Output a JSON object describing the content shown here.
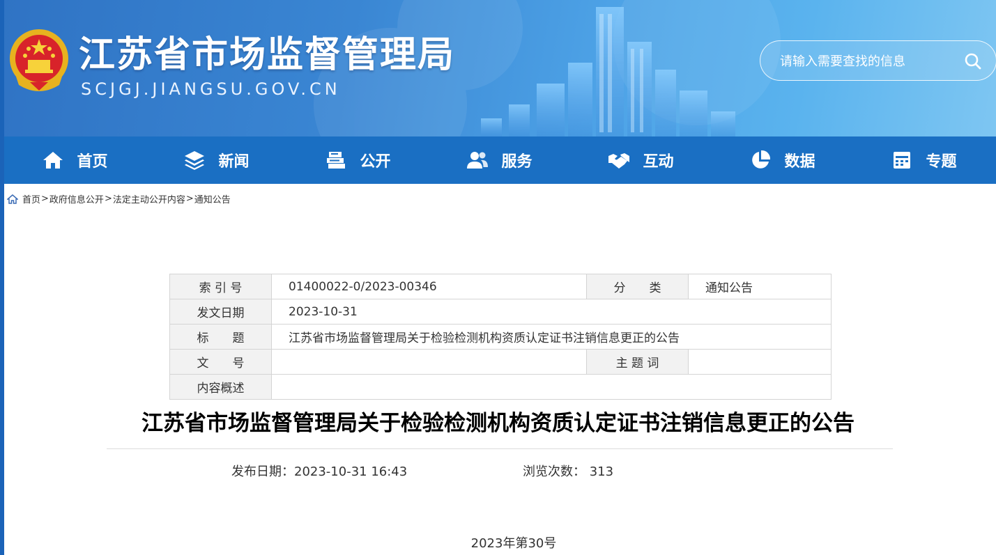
{
  "header": {
    "site_title": "江苏省市场监督管理局",
    "site_domain": "SCJGJ.JIANGSU.GOV.CN",
    "search_placeholder": "请输入需要查找的信息"
  },
  "nav": [
    {
      "label": "首页",
      "icon": "home-icon"
    },
    {
      "label": "新闻",
      "icon": "layers-icon"
    },
    {
      "label": "公开",
      "icon": "document-stack-icon"
    },
    {
      "label": "服务",
      "icon": "users-icon"
    },
    {
      "label": "互动",
      "icon": "handshake-icon"
    },
    {
      "label": "数据",
      "icon": "pie-chart-icon"
    },
    {
      "label": "专题",
      "icon": "calendar-icon"
    }
  ],
  "breadcrumb": [
    "首页",
    "政府信息公开",
    "法定主动公开内容",
    "通知公告"
  ],
  "breadcrumb_sep": ">",
  "info_table": {
    "index_label": "索 引 号",
    "index_value": "01400022-0/2023-00346",
    "category_label": "分　　类",
    "category_value": "通知公告",
    "date_label": "发文日期",
    "date_value": "2023-10-31",
    "title_label": "标　　题",
    "title_value": "江苏省市场监督管理局关于检验检测机构资质认定证书注销信息更正的公告",
    "docno_label": "文　　号",
    "docno_value": "",
    "keyword_label": "主 题 词",
    "keyword_value": "",
    "summary_label": "内容概述",
    "summary_value": ""
  },
  "article": {
    "title": "江苏省市场监督管理局关于检验检测机构资质认定证书注销信息更正的公告",
    "publish_label": "发布日期：",
    "publish_value": "2023-10-31 16:43",
    "views_label": "浏览次数：",
    "views_value": "313",
    "issue": "2023年第30号"
  }
}
